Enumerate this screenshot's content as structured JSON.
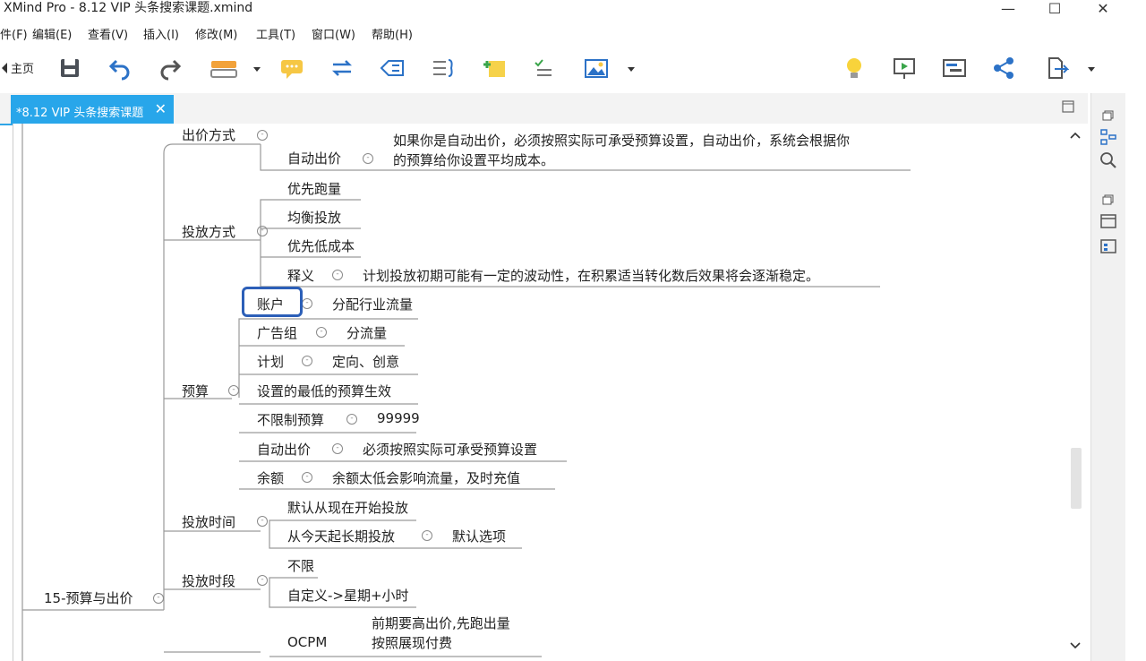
{
  "window": {
    "title": "XMind Pro - 8.12 VIP 头条搜索课题.xmind",
    "min_glyph": "—",
    "max_glyph": "☐",
    "close_glyph": "✕"
  },
  "menu": [
    "件(F)",
    "编辑(E)",
    "查看(V)",
    "插入(I)",
    "修改(M)",
    "工具(T)",
    "窗口(W)",
    "帮助(H)"
  ],
  "toolbar": {
    "home_label": "主页"
  },
  "tab": {
    "label": "*8.12 VIP 头条搜索课题",
    "close": "✕"
  },
  "map": {
    "chujia_fangshi": "出价方式",
    "zidong_chujia": "自动出价",
    "zidong_chujia_note_1": "如果你是自动出价，必须按照实际可承受预算设置，自动出价，系统会根据你",
    "zidong_chujia_note_2": "的预算给你设置平均成本。",
    "toufang_fangshi": "投放方式",
    "youxian_paoliang": "优先跑量",
    "junheng_toufang": "均衡投放",
    "youxian_dichengben": "优先低成本",
    "shiyi": "释义",
    "shiyi_note": "计划投放初期可能有一定的波动性，在积累适当转化数后效果将会逐渐稳定。",
    "yusuan": "预算",
    "zhanghu": "账户",
    "zhanghu_note": "分配行业流量",
    "guanggaozu": "广告组",
    "guanggaozu_note": "分流量",
    "jihua": "计划",
    "jihua_note": "定向、创意",
    "zuidi_yusuan": "设置的最低的预算生效",
    "buxianzhi": "不限制预算",
    "buxianzhi_note": "99999",
    "zidong_chujia2": "自动出价",
    "zidong_chujia2_note": "必须按照实际可承受预算设置",
    "yue": "余额",
    "yue_note": "余额太低会影响流量，及时充值",
    "toufang_shijian": "投放时间",
    "moren_kaishi": "默认从现在开始投放",
    "changqi_toufang": "从今天起长期投放",
    "moren_xuanxiang": "默认选项",
    "toufang_shiduan": "投放时段",
    "buxian": "不限",
    "zidingyi": "自定义->星期+小时",
    "root": "15-预算与出价",
    "ocpm": "OCPM",
    "ocpm_note_1": "前期要高出价,先跑出量",
    "ocpm_note_2": "按照展现付费"
  },
  "colors": {
    "accent": "#28a6ea",
    "selection": "#2c5fb8",
    "line": "#9a9a9a"
  }
}
